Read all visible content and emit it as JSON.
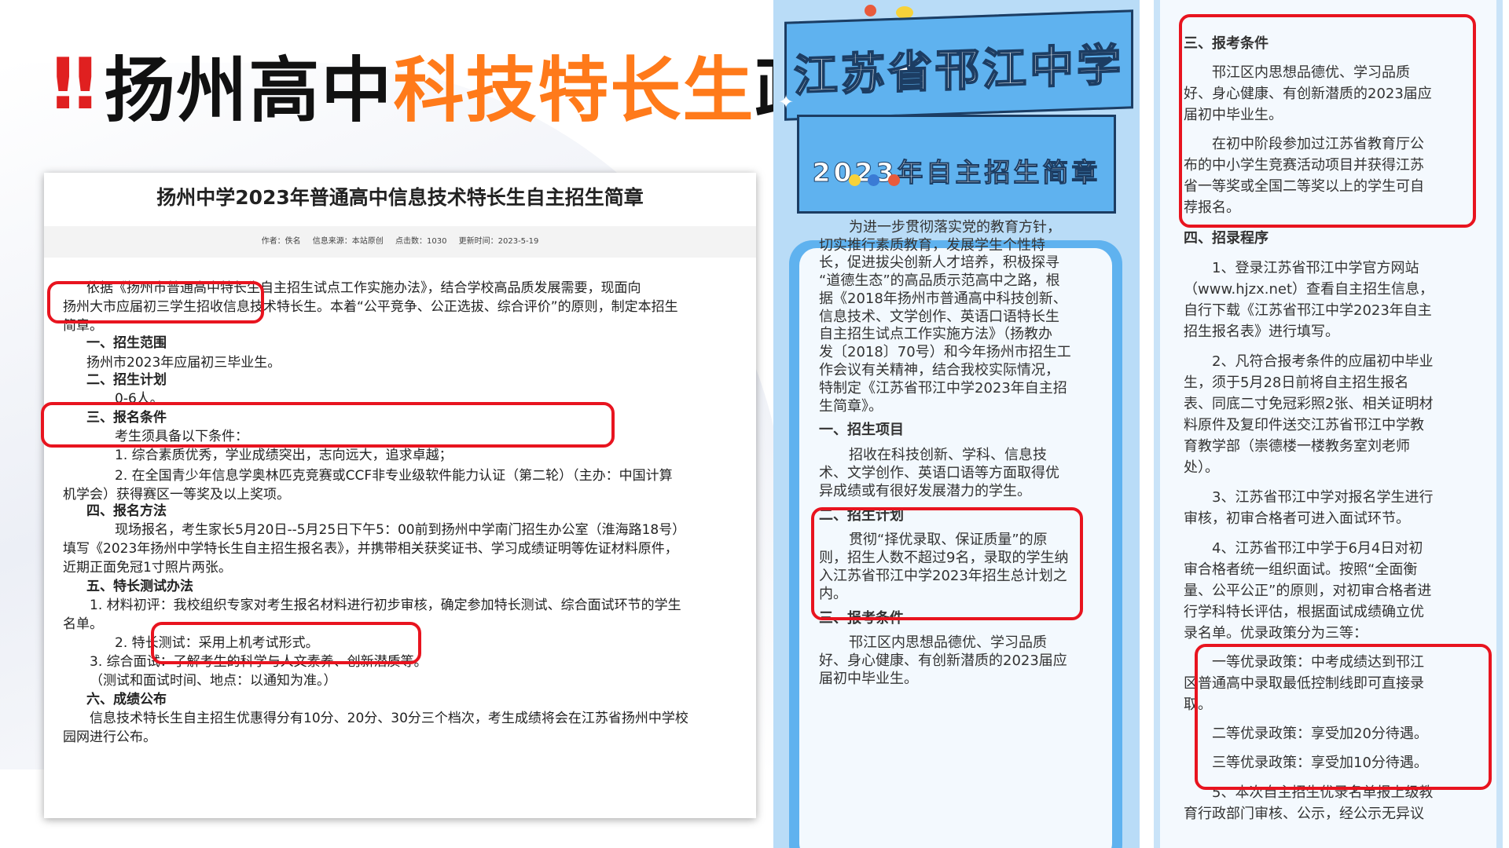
{
  "headline": {
    "bang": "‼",
    "part1": "扬州高中",
    "part2": "科技特长生",
    "part3": "政策"
  },
  "doc1": {
    "title": "扬州中学2023年普通高中信息技术特长生自主招生简章",
    "meta": {
      "author": "作者：佚名",
      "source": "信息来源：本站原创",
      "clicks": "点击数：1030",
      "updated": "更新时间：2023-5-19"
    },
    "lines": [
      "依据《扬州市普通高中特长生自主招生试点工作实施办法》，结合学校高品质发展需要，现面向",
      "扬州大市应届初三学生招收信息技术特长生。本着“公平竞争、公正选拔、综合评价”的原则，制定本招生",
      "简章。",
      "一、招生范围",
      "扬州市2023年应届初三毕业生。",
      "二、招生计划",
      "0-6人。",
      "三、报名条件",
      "考生须具备以下条件：",
      "1. 综合素质优秀，学业成绩突出，志向远大，追求卓越；",
      "2. 在全国青少年信息学奥林匹克竞赛或CCF非专业级软件能力认证（第二轮）（主办：中国计算",
      "机学会）获得赛区一等奖及以上奖项。",
      "四、报名方法",
      "现场报名，考生家长5月20日--5月25日下午5：00前到扬州中学南门招生办公室（淮海路18号）",
      "填写《2023年扬州中学特长生自主招生报名表》，并携带相关获奖证书、学习成绩证明等佐证材料原件，",
      "近期正面免冠1寸照片两张。",
      "五、特长测试办法",
      "1. 材料初评：我校组织专家对考生报名材料进行初步审核，确定参加特长测试、综合面试环节的学生",
      "名单。",
      "2. 特长测试：采用上机考试形式。",
      "3. 综合面试：了解考生的科学与人文素养、创新潜质等。",
      "（测试和面试时间、地点：以通知为准。）",
      "六、成绩公布",
      "信息技术特长生自主招生优惠得分有10分、20分、30分三个档次，考生成绩将会在江苏省扬州中学校",
      "园网进行公布。"
    ]
  },
  "poster": {
    "title": "江苏省邗江中学",
    "subtitle": "2023年自主招生简章",
    "lines": [
      "为进一步贯彻落实党的教育方针，",
      "切实推行素质教育，发展学生个性特",
      "长，促进拔尖创新人才培养，积极探寻",
      "“道德生态”的高品质示范高中之路，根",
      "据《2018年扬州市普通高中科技创新、",
      "信息技术、文学创作、英语口语特长生",
      "自主招生试点工作实施方法》（扬教办",
      "发〔2018〕70号）和今年扬州市招生工",
      "作会议有关精神，结合我校实际情况，",
      "特制定《江苏省邗江中学2023年自主招",
      "生简章》。",
      "一、招生项目",
      "招收在科技创新、学科、信息技",
      "术、文学创作、英语口语等方面取得优",
      "异成绩或有很好发展潜力的学生。",
      "二、招生计划",
      "贯彻“择优录取、保证质量”的原",
      "则，招生人数不超过9名，录取的学生纳",
      "入江苏省邗江中学2023年招生总计划之",
      "内。",
      "三、报考条件",
      "邗江区内思想品德优、学习品质",
      "好、身心健康、有创新潜质的2023届应",
      "届初中毕业生。"
    ]
  },
  "panel": {
    "lines": [
      "三、报考条件",
      "邗江区内思想品德优、学习品质",
      "好、身心健康、有创新潜质的2023届应",
      "届初中毕业生。",
      "在初中阶段参加过江苏省教育厅公",
      "布的中小学生竞赛活动项目并获得江苏",
      "省一等奖或全国二等奖以上的学生可自",
      "荐报名。",
      "四、招录程序",
      "1、登录江苏省邗江中学官方网站",
      "（www.hjzx.net）查看自主招生信息，",
      "自行下载《江苏省邗江中学2023年自主",
      "招生报名表》进行填写。",
      "2、凡符合报考条件的应届初中毕业",
      "生，须于5月28日前将自主招生报名",
      "表、同底二寸免冠彩照2张、相关证明材",
      "料原件及复印件送交江苏省邗江中学教",
      "育教学部（崇德楼一楼教务室刘老师",
      "处）。",
      "3、江苏省邗江中学对报名学生进行",
      "审核，初审合格者可进入面试环节。",
      "4、江苏省邗江中学于6月4日对初",
      "审合格者统一组织面试。按照“全面衡",
      "量、公平公正”的原则，对初审合格者进",
      "行学科特长评估，根据面试成绩确立优",
      "录名单。优录政策分为三等：",
      "一等优录政策：中考成绩达到邗江",
      "区普通高中录取最低控制线即可直接录",
      "取。",
      "二等优录政策：享受加20分待遇。",
      "三等优录政策：享受加10分待遇。",
      "5、本次自主招生优录名单报上级教",
      "育行政部门审核、公示，经公示无异议"
    ]
  },
  "colors": {
    "highlight_red": "#e8141f",
    "headline_orange": "#ff7a1a",
    "poster_blue": "#5fb2ef",
    "poster_bg": "#b9dcf7"
  }
}
